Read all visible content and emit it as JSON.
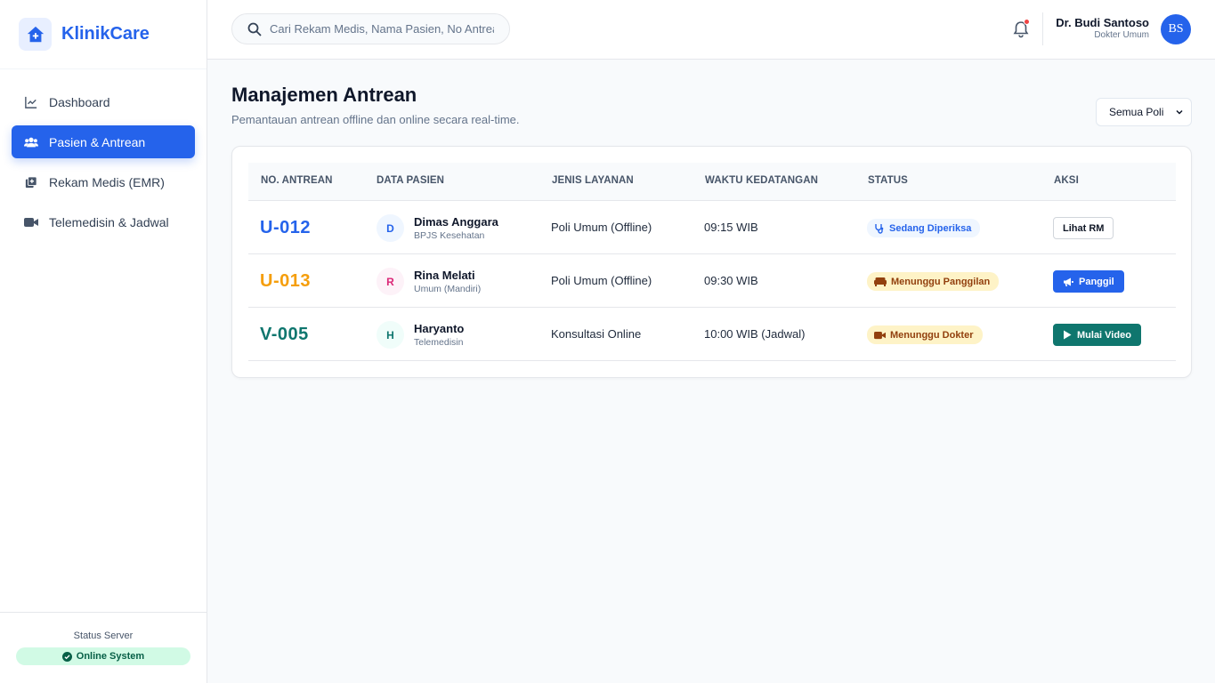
{
  "colors": {
    "primary": "#2563eb",
    "success_bg": "#d1fae5",
    "success_text": "#065f46",
    "warning_bg": "#fef3c7",
    "warning_text": "#92400e",
    "info_bg": "#eff6ff",
    "teal": "#0f766e",
    "orange": "#f59e0b",
    "notification_dot": "#ef4444"
  },
  "brand": {
    "name": "KlinikCare",
    "icon": "house-plus-icon"
  },
  "sidebar": {
    "items": [
      {
        "label": "Dashboard",
        "icon": "chart-line-icon",
        "active": false
      },
      {
        "label": "Pasien & Antrean",
        "icon": "users-icon",
        "active": true
      },
      {
        "label": "Rekam Medis (EMR)",
        "icon": "medical-record-icon",
        "active": false
      },
      {
        "label": "Telemedisin & Jadwal",
        "icon": "video-camera-icon",
        "active": false
      }
    ],
    "footer": {
      "label": "Status Server",
      "status": "Online System",
      "icon": "check-circle-icon"
    }
  },
  "header": {
    "search_placeholder": "Cari Rekam Medis, Nama Pasien, No Antrean...",
    "notification_icon": "bell-icon",
    "user": {
      "name": "Dr. Budi Santoso",
      "role": "Dokter Umum",
      "initials": "BS"
    }
  },
  "main": {
    "title": "Manajemen Antrean",
    "subtitle": "Pemantauan antrean offline dan online secara real-time.",
    "filter": {
      "selected": "Semua Poli"
    },
    "table": {
      "columns": [
        "NO. ANTREAN",
        "DATA PASIEN",
        "JENIS LAYANAN",
        "WAKTU KEDATANGAN",
        "STATUS",
        "AKSI"
      ],
      "rows": [
        {
          "queue_no": "U-012",
          "queue_color": "#2563eb",
          "initial": "D",
          "avatar_bg": "#eff6ff",
          "avatar_color": "#2563eb",
          "name": "Dimas Anggara",
          "patient_type": "BPJS Kesehatan",
          "service": "Poli Umum (Offline)",
          "arrival": "09:15 WIB",
          "status": "Sedang Diperiksa",
          "status_icon": "stethoscope-icon",
          "status_bg": "#eff6ff",
          "status_color": "#2563eb",
          "action": "Lihat RM",
          "action_icon": "",
          "action_style": "outline"
        },
        {
          "queue_no": "U-013",
          "queue_color": "#f59e0b",
          "initial": "R",
          "avatar_bg": "#fdf2f8",
          "avatar_color": "#db2777",
          "name": "Rina Melati",
          "patient_type": "Umum (Mandiri)",
          "service": "Poli Umum (Offline)",
          "arrival": "09:30 WIB",
          "status": "Menunggu Panggilan",
          "status_icon": "couch-icon",
          "status_bg": "#fef3c7",
          "status_color": "#92400e",
          "action": "Panggil",
          "action_icon": "megaphone-icon",
          "action_style": "blue"
        },
        {
          "queue_no": "V-005",
          "queue_color": "#0f766e",
          "initial": "H",
          "avatar_bg": "#f0fdfa",
          "avatar_color": "#0f766e",
          "name": "Haryanto",
          "patient_type": "Telemedisin",
          "service": "Konsultasi Online",
          "arrival": "10:00 WIB (Jadwal)",
          "status": "Menunggu Dokter",
          "status_icon": "video-camera-icon",
          "status_bg": "#fef3c7",
          "status_color": "#92400e",
          "action": "Mulai Video",
          "action_icon": "play-icon",
          "action_style": "teal"
        }
      ]
    }
  }
}
